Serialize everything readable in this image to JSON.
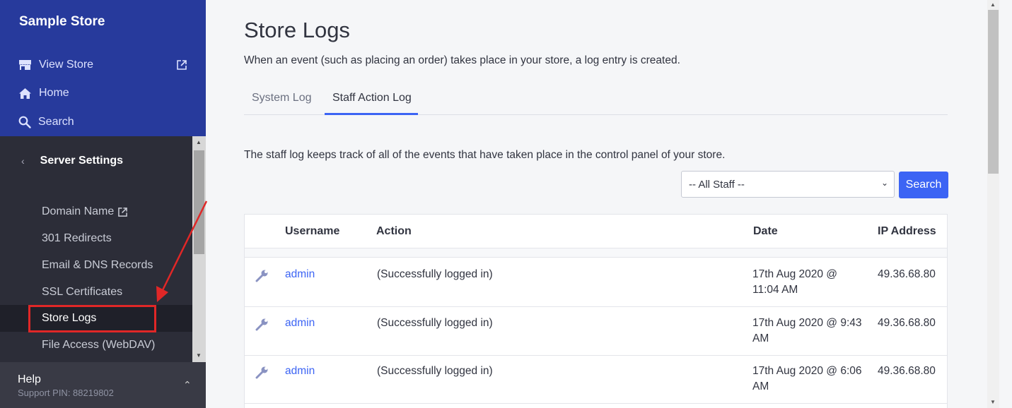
{
  "sidebar": {
    "store_name": "Sample Store",
    "nav": [
      {
        "label": "View Store",
        "icon": "store-icon"
      },
      {
        "label": "Home",
        "icon": "home-icon"
      },
      {
        "label": "Search",
        "icon": "search-icon"
      }
    ],
    "section_title": "Server Settings",
    "items": [
      {
        "label": "Domain Name"
      },
      {
        "label": "301 Redirects"
      },
      {
        "label": "Email & DNS Records"
      },
      {
        "label": "SSL Certificates"
      },
      {
        "label": "Store Logs"
      },
      {
        "label": "File Access (WebDAV)"
      }
    ],
    "help": {
      "title": "Help",
      "pin": "Support PIN: 88219802"
    }
  },
  "main": {
    "title": "Store Logs",
    "description": "When an event (such as placing an order) takes place in your store, a log entry is created.",
    "tabs": [
      {
        "label": "System Log",
        "active": false
      },
      {
        "label": "Staff Action Log",
        "active": true
      }
    ],
    "staff_description": "The staff log keeps track of all of the events that have taken place in the control panel of your store.",
    "filter": {
      "selected": "-- All Staff --",
      "search_label": "Search"
    },
    "table": {
      "columns": [
        "Username",
        "Action",
        "Date",
        "IP Address"
      ],
      "rows": [
        {
          "username": "admin",
          "action": "(Successfully logged in)",
          "date": "17th Aug 2020 @ 11:04 AM",
          "ip": "49.36.68.80"
        },
        {
          "username": "admin",
          "action": "(Successfully logged in)",
          "date": "17th Aug 2020 @ 9:43 AM",
          "ip": "49.36.68.80"
        },
        {
          "username": "admin",
          "action": "(Successfully logged in)",
          "date": "17th Aug 2020 @ 6:06 AM",
          "ip": "49.36.68.80"
        }
      ]
    }
  },
  "colors": {
    "sidebar_top": "#273a9c",
    "sidebar_dark": "#2a2c36",
    "accent": "#3c64f4",
    "annotation": "#e02727"
  }
}
